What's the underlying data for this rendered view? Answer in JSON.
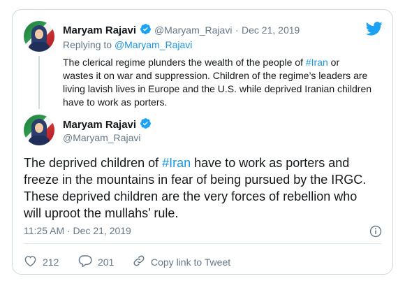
{
  "quoted_tweet": {
    "author_name": "Maryam Rajavi",
    "author_handle": "@Maryam_Rajavi",
    "separator": "·",
    "date": "Dec 21, 2019",
    "replying_to_label": "Replying to",
    "replying_to_handle": "@Maryam_Rajavi",
    "text_before_hashtag": "The clerical regime plunders the wealth of the people of ",
    "hashtag": "#Iran",
    "text_line1_end": " or",
    "text_line2": "wastes it on war and suppression. Children of the regime’s leaders are",
    "text_line3": "living lavish lives in Europe and the U.S. while deprived Iranian children",
    "text_line4": "have to work as porters."
  },
  "main_tweet": {
    "author_name": "Maryam Rajavi",
    "author_handle": "@Maryam_Rajavi",
    "text_start": "The deprived children of ",
    "hashtag": "#Iran",
    "text_line1_end": " have to work as porters and",
    "text_line2": "freeze in the mountains in fear of being pursued by the IRGC.",
    "text_line3": "These deprived children are the very forces of rebellion who",
    "text_line4": "will uproot the mullahs’ rule.",
    "timestamp": "11:25 AM · Dec 21, 2019"
  },
  "actions": {
    "likes": "212",
    "replies": "201",
    "copy_link_label": "Copy link to Tweet"
  },
  "colors": {
    "twitter_blue": "#1da1f2",
    "link_blue": "#1b95e0",
    "text": "#14171a",
    "muted": "#657786",
    "border": "#cfd9de"
  },
  "icons": [
    "twitter-bird-icon",
    "verified-badge-icon",
    "info-icon",
    "heart-icon",
    "reply-icon",
    "link-icon"
  ]
}
